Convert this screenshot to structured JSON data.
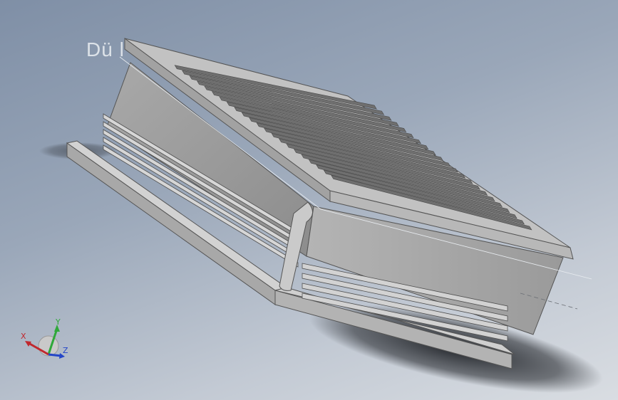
{
  "viewport": {
    "plane_label": "Dü      l",
    "background_top": "#7f8fa6",
    "background_bottom": "#d9dde2"
  },
  "model": {
    "name": "slotted-block-part",
    "top_slot_count": 22,
    "left_rib_count": 5,
    "front_rib_count": 4,
    "face_colors": {
      "top": "#b9b9b9",
      "side_light": "#c8c8c8",
      "side_dark": "#8e8e8e",
      "edge": "#5a5a5a"
    }
  },
  "triad": {
    "x_label": "X",
    "y_label": "Y",
    "z_label": "Z",
    "x_color": "#c0282d",
    "y_color": "#2fa83a",
    "z_color": "#2446c8"
  }
}
